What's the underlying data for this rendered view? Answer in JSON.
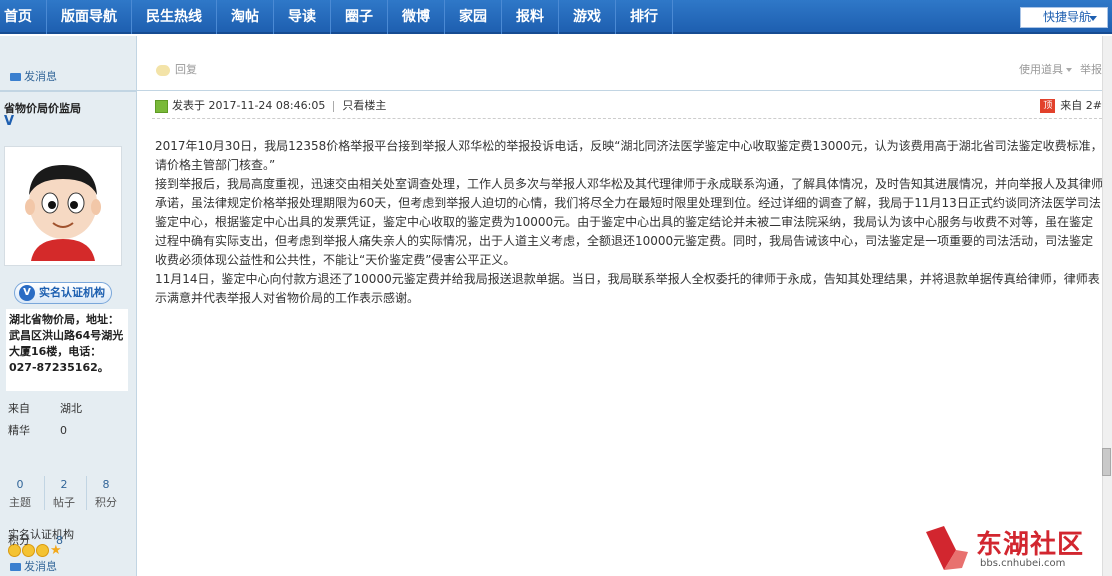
{
  "nav": {
    "items": [
      "首页",
      "版面导航",
      "民生热线",
      "淘帖",
      "导读",
      "圈子",
      "微博",
      "家园",
      "报料",
      "游戏",
      "排行"
    ],
    "quick_nav": "快捷导航"
  },
  "prev_post": {
    "send_msg": "发消息",
    "reply": "回复",
    "tools": "使用道具",
    "report": "举报"
  },
  "user": {
    "name": "省物价局价监局",
    "vmark": "V",
    "cert_label": "实名认证机构",
    "cert_v": "V",
    "address": "湖北省物价局，地址：武昌区洪山路64号湖光大厦16楼，电话：027-87235162。",
    "from_label": "来自",
    "from_value": "湖北",
    "jinghua_label": "精华",
    "jinghua_value": "0",
    "stats": [
      {
        "num": "0",
        "label": "主题"
      },
      {
        "num": "2",
        "label": "帖子"
      },
      {
        "num": "8",
        "label": "积分"
      }
    ],
    "realname_group": "实名认证机构",
    "star_glyph": "★",
    "jifen_label": "积分",
    "jifen_value": "8",
    "send_msg": "发消息"
  },
  "post": {
    "posted_at": "发表于 2017-11-24 08:46:05",
    "only_author": "只看楼主",
    "floor_tag": "顶",
    "floor": "来自 2#",
    "paragraphs": [
      "2017年10月30日，我局12358价格举报平台接到举报人邓华松的举报投诉电话，反映“湖北同济法医学鉴定中心收取鉴定费13000元，认为该费用高于湖北省司法鉴定收费标准，请价格主管部门核查。”",
      "接到举报后，我局高度重视，迅速交由相关处室调查处理，工作人员多次与举报人邓华松及其代理律师于永成联系沟通，了解具体情况，及时告知其进展情况，并向举报人及其律师承诺，虽法律规定价格举报处理期限为60天，但考虑到举报人迫切的心情，我们将尽全力在最短时限里处理到位。经过详细的调查了解，我局于11月13日正式约谈同济法医学司法鉴定中心，根据鉴定中心出具的发票凭证，鉴定中心收取的鉴定费为10000元。由于鉴定中心出具的鉴定结论并未被二审法院采纳，我局认为该中心服务与收费不对等，虽在鉴定过程中确有实际支出，但考虑到举报人痛失亲人的实际情况，出于人道主义考虑，全额退还10000元鉴定费。同时，我局告诫该中心，司法鉴定是一项重要的司法活动，司法鉴定收费必须体现公益性和公共性，不能让“天价鉴定费”侵害公平正义。",
      "11月14日，鉴定中心向付款方退还了10000元鉴定费并给我局报送退款单据。当日，我局联系举报人全权委托的律师于永成，告知其处理结果，并将退款单据传真给律师，律师表示满意并代表举报人对省物价局的工作表示感谢。"
    ]
  },
  "watermark": {
    "name": "东湖社区",
    "url": "bbs.cnhubei.com"
  },
  "colors": {
    "nav_bg": "#1e5fb0",
    "side_bg": "#e5edf2",
    "accent_red": "#d2262f",
    "link_blue": "#336699"
  }
}
